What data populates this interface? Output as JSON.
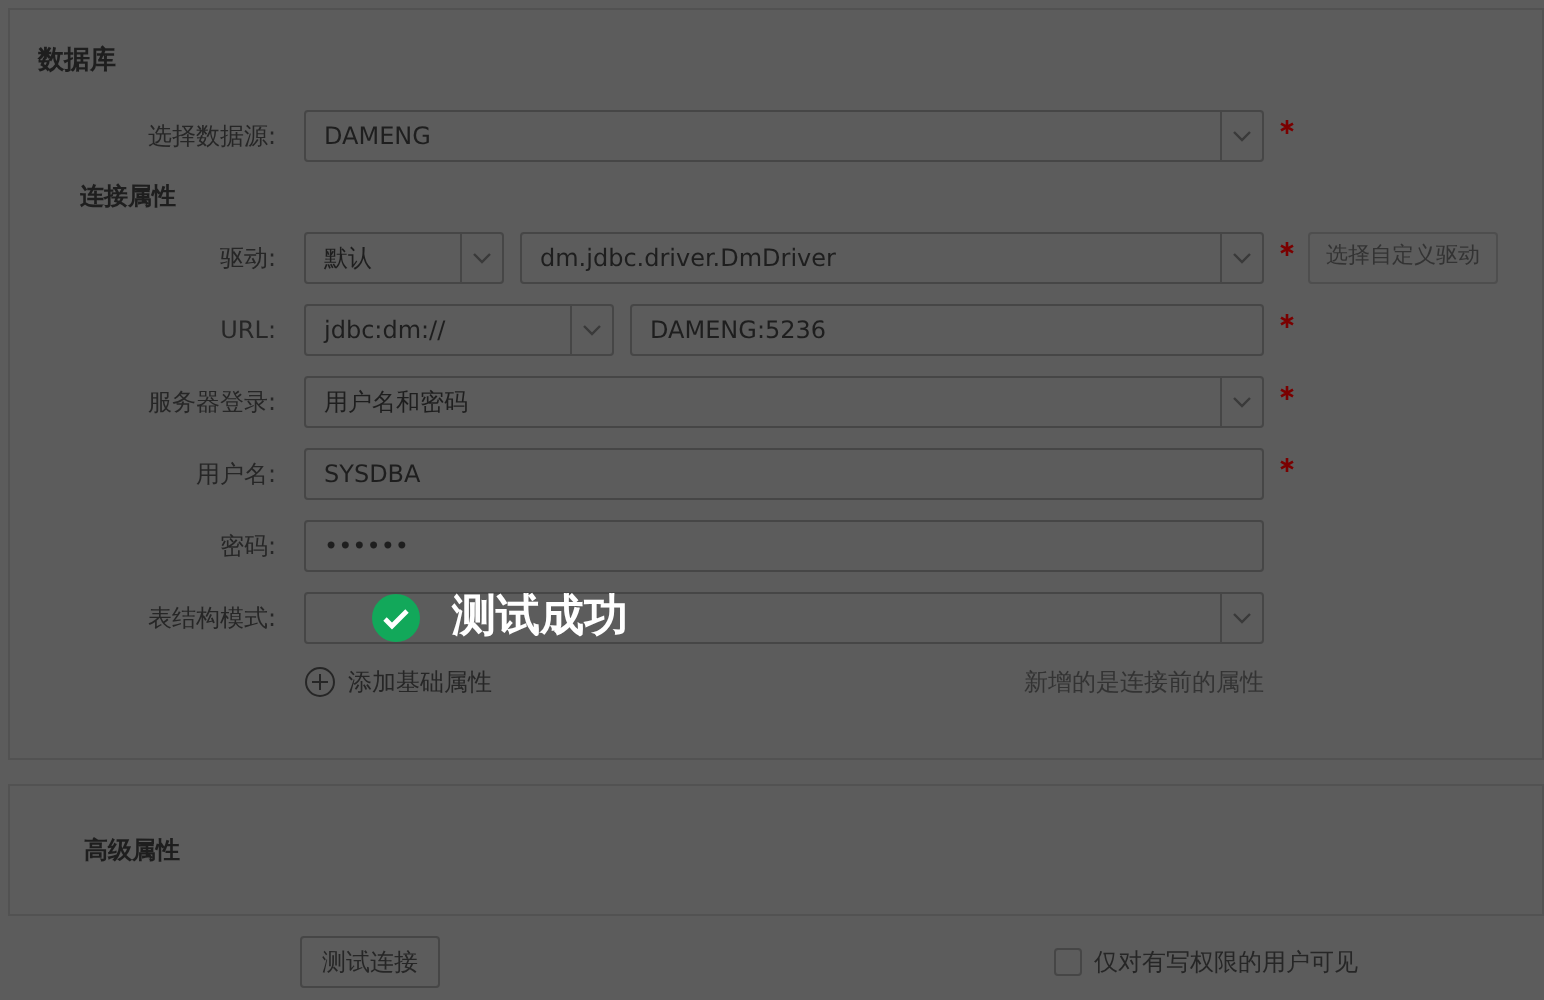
{
  "database": {
    "title": "数据库",
    "source": {
      "label": "选择数据源:",
      "required": true,
      "value": "DAMENG"
    },
    "connection_title": "连接属性",
    "rows": [
      {
        "kind": "driver",
        "label": "驱动:",
        "required": true,
        "controls": [
          {
            "kind": "select",
            "value": "默认"
          },
          {
            "kind": "select",
            "value": "dm.jdbc.driver.DmDriver"
          }
        ],
        "button": {
          "label": "选择自定义驱动",
          "disabled": true
        }
      },
      {
        "kind": "url",
        "label": "URL:",
        "required": true,
        "controls": [
          {
            "kind": "select",
            "value": "jdbc:dm://"
          },
          {
            "kind": "input",
            "value": "DAMENG:5236"
          }
        ]
      },
      {
        "kind": "single",
        "label": "服务器登录:",
        "required": true,
        "controls": [
          {
            "kind": "select",
            "value": "用户名和密码"
          }
        ]
      },
      {
        "kind": "single",
        "label": "用户名:",
        "required": true,
        "controls": [
          {
            "kind": "input",
            "value": "SYSDBA"
          }
        ]
      },
      {
        "kind": "single",
        "label": "密码:",
        "required": false,
        "controls": [
          {
            "kind": "input",
            "value": "••••••"
          }
        ]
      },
      {
        "kind": "single",
        "label": "表结构模式:",
        "required": false,
        "controls": [
          {
            "kind": "select"
          }
        ]
      }
    ],
    "add_link": "添加基础属性",
    "hint": "新增的是连接前的属性"
  },
  "advanced": {
    "title": "高级属性"
  },
  "test_button": "测试连接",
  "write_only": {
    "label": "仅对有写权限的用户可见",
    "checked": false
  },
  "toast": {
    "text": "测试成功"
  }
}
